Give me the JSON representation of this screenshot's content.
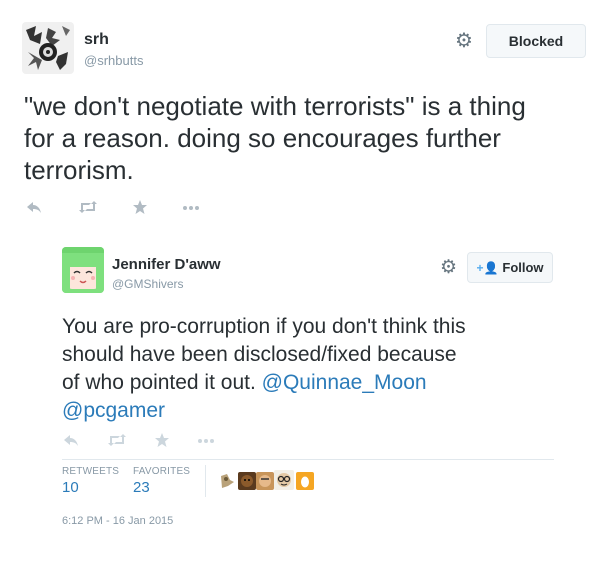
{
  "tweet": {
    "name": "srh",
    "handle": "@srhbutts",
    "text": "\"we don't negotiate with terrorists\" is a thing for a reason. doing so encourages further terrorism.",
    "text_lines": [
      "\"we don't negotiate with terrorists\" is a thing",
      "for a reason. doing so encourages further",
      "terrorism."
    ],
    "blocked_label": "Blocked"
  },
  "embedded": {
    "name": "Jennifer D'aww",
    "handle": "@GMShivers",
    "text_lines": [
      "You are pro-corruption if you don't think this",
      "should have been disclosed/fixed because",
      "of who pointed it out. ",
      "@pcgamer"
    ],
    "mention_inline": "@Quinnae_Moon",
    "follow_label": "Follow",
    "retweets_label": "RETWEETS",
    "retweets": "10",
    "favorites_label": "FAVORITES",
    "favorites": "23",
    "timestamp": "6:12 PM - 16 Jan 2015"
  },
  "colors": {
    "link": "#2b7bb9",
    "muted": "#8899a6",
    "text": "#292f33"
  },
  "icons": [
    "reply-icon",
    "retweet-icon",
    "favorite-icon",
    "more-icon",
    "gear-icon",
    "follow-icon"
  ]
}
